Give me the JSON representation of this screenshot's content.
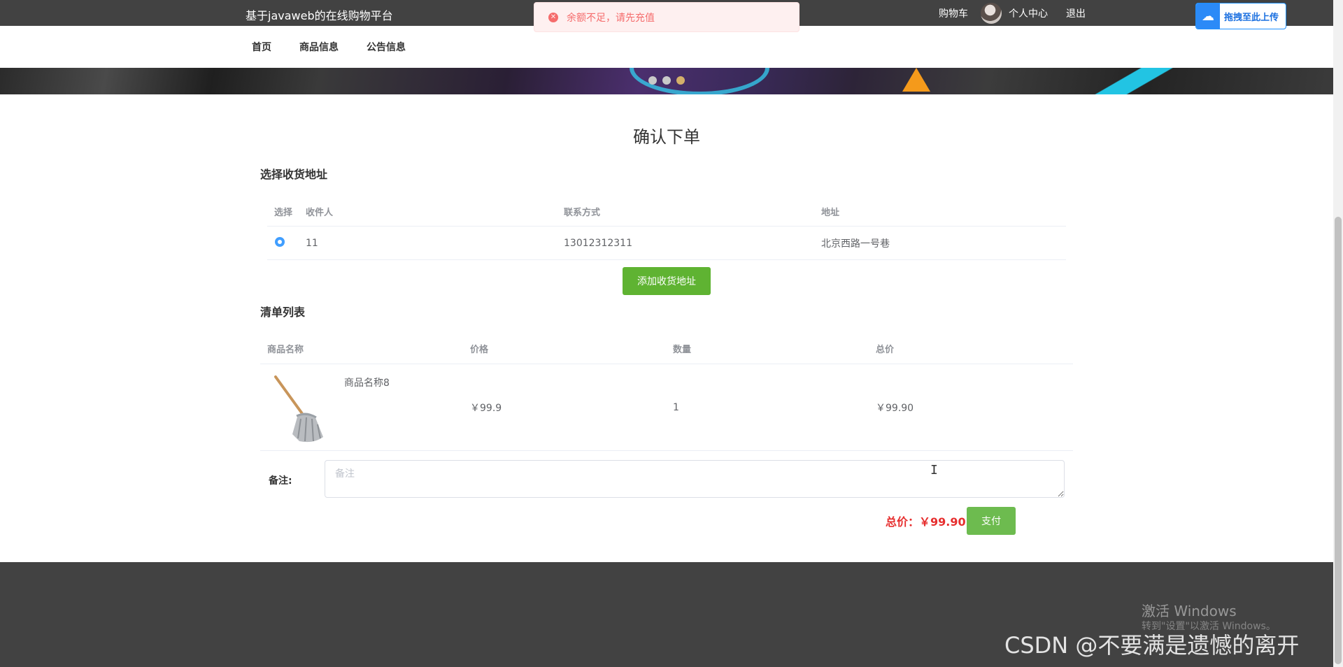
{
  "header": {
    "site_title": "基于javaweb的在线购物平台",
    "cart": "购物车",
    "profile": "个人中心",
    "logout": "退出"
  },
  "toast": {
    "message": "余额不足，请先充值"
  },
  "upload_widget": {
    "label": "拖拽至此上传"
  },
  "nav": {
    "home": "首页",
    "products": "商品信息",
    "notices": "公告信息"
  },
  "page": {
    "title": "确认下单"
  },
  "address_section": {
    "title": "选择收货地址",
    "columns": [
      "选择",
      "收件人",
      "联系方式",
      "地址"
    ],
    "rows": [
      {
        "selected": true,
        "recipient": "11",
        "phone": "13012312311",
        "address": "北京西路一号巷"
      }
    ],
    "add_button": "添加收货地址"
  },
  "order_section": {
    "title": "清单列表",
    "columns": [
      "商品名称",
      "价格",
      "数量",
      "总价"
    ],
    "items": [
      {
        "name": "商品名称8",
        "price": "￥99.9",
        "quantity": "1",
        "total": "￥99.90"
      }
    ]
  },
  "remark": {
    "label": "备注:",
    "placeholder": "备注",
    "value": ""
  },
  "summary": {
    "total_label": "总价：￥99.90",
    "pay_button": "支付"
  },
  "watermarks": {
    "windows_line1": "激活 Windows",
    "windows_line2": "转到\"设置\"以激活 Windows。",
    "csdn": "CSDN @不要满是遗憾的离开"
  },
  "colors": {
    "topbar": "#424242",
    "primary_green": "#5fb332",
    "total_red": "#e62e2e",
    "error": "#f56c6c"
  }
}
